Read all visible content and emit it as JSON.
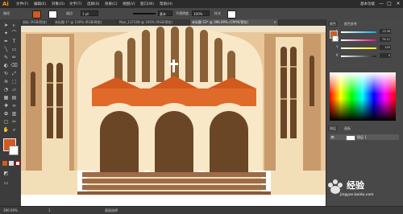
{
  "app": {
    "logo": "Ai"
  },
  "menubar": {
    "items": [
      "文件(F)",
      "编辑(E)",
      "对象(O)",
      "文字(T)",
      "选择(S)",
      "效果(C)",
      "视图(V)",
      "窗口(W)",
      "帮助(H)"
    ],
    "workspace": "基本功能",
    "minimize": "—",
    "maximize": "□",
    "close": "✕"
  },
  "controlbar": {
    "path_label": "路径",
    "stroke_label": "描边",
    "stroke_weight": "1 pt",
    "brush_value": "基本",
    "opacity_label": "不透明度",
    "opacity_value": "100%",
    "style_label": "样式",
    "colors": {
      "fill": "#d35a1e",
      "stroke": "#ffffff"
    }
  },
  "tabs": [
    {
      "label": "鼠标 (RGB/预览)",
      "active": false
    },
    {
      "label": "未标题-1* @ 100% (RGB/预览)",
      "active": false
    },
    {
      "label": "Mpa_137108 @ 100% (RGB/预览)",
      "active": false
    },
    {
      "label": "未标题-53* @ 396.09% (CMYK/预览)",
      "active": true
    }
  ],
  "tools": [
    "selection-arrow-icon",
    "direct-selection-icon",
    "magic-wand-icon",
    "lasso-icon",
    "pen-icon",
    "type-icon",
    "line-icon",
    "rectangle-icon",
    "brush-icon",
    "pencil-icon",
    "blob-brush-icon",
    "eraser-icon",
    "rotate-icon",
    "scale-icon",
    "width-icon",
    "free-transform-icon",
    "shape-builder-icon",
    "perspective-icon",
    "mesh-icon",
    "gradient-icon",
    "eyedropper-icon",
    "blend-icon",
    "symbol-sprayer-icon",
    "graph-icon",
    "artboard-icon",
    "slice-icon",
    "hand-icon",
    "zoom-icon"
  ],
  "panels": {
    "color_tab": "颜色",
    "guide_tab": "颜色参考",
    "sliders": [
      {
        "label": "C",
        "value": "13.36",
        "color": "#00aeef"
      },
      {
        "label": "M",
        "value": "76.11",
        "color": "#ec008c"
      },
      {
        "label": "Y",
        "value": "100",
        "color": "#fff200"
      },
      {
        "label": "K",
        "value": "0",
        "color": "#231f20"
      }
    ],
    "layers_tabs": [
      "图层",
      "画板"
    ],
    "layers": [
      {
        "name": "图层 1"
      }
    ]
  },
  "status": {
    "zoom": "396.09%",
    "page": "1",
    "tool_name": "直接选择"
  },
  "watermark": {
    "text": "经验",
    "site": "jingyan.baidu.com"
  },
  "artwork": {
    "colors": {
      "sky": "#e8c79a",
      "tower": "#c99a6b",
      "dark_brown": "#6a4626",
      "cream": "#f8e8c8",
      "wall": "#f3dfb7",
      "orange": "#d35a1e",
      "tan_window": "#8a6138"
    }
  }
}
